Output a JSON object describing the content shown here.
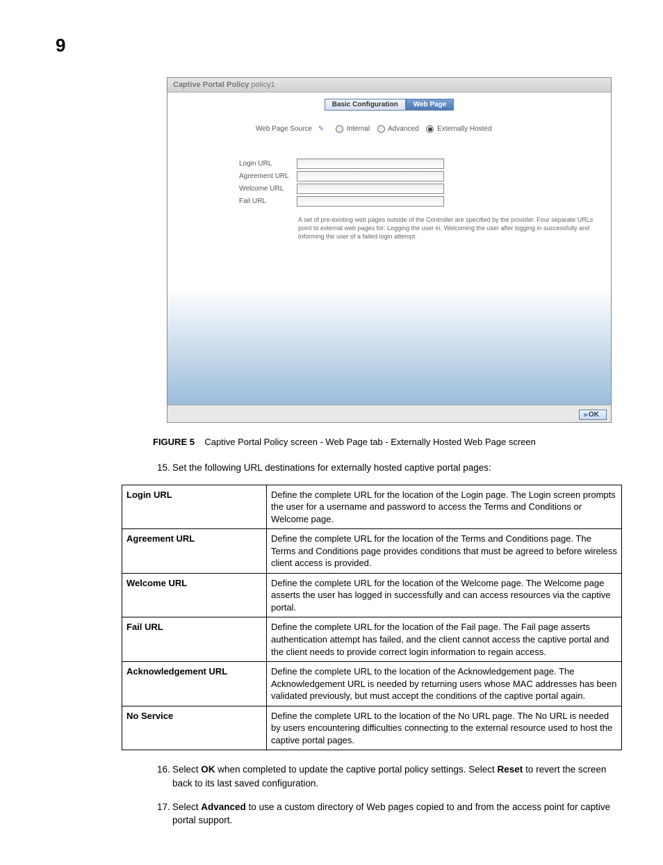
{
  "chapter": "9",
  "screenshot": {
    "title_label": "Captive Portal Policy",
    "title_value": "policy1",
    "tabs": {
      "basic": "Basic Configuration",
      "webpage": "Web Page"
    },
    "source_label": "Web Page Source",
    "radios": {
      "internal": "Internal",
      "advanced": "Advanced",
      "external": "Externally Hosted"
    },
    "url_labels": {
      "login": "Login URL",
      "agreement": "Agreement URL",
      "welcome": "Welcome URL",
      "fail": "Fail URL"
    },
    "note": "A set of pre-existing web pages outside of the Controller are specified by the provider. Four separate URLs point to external web pages for: Logging the user in, Welcoming the user after logging in successfully and Informing the user of a failed login attempt.",
    "ok": "OK"
  },
  "figure": {
    "label": "FIGURE 5",
    "caption": "Captive Portal Policy screen - Web Page tab - Externally Hosted Web Page screen"
  },
  "step15": {
    "num": "15.",
    "text": "Set the following URL destinations for externally hosted captive portal pages:"
  },
  "table": [
    {
      "term": "Login URL",
      "desc": "Define the complete URL for the location of the Login page. The Login screen prompts the user for a username and password to access the Terms and Conditions or Welcome page."
    },
    {
      "term": "Agreement URL",
      "desc": "Define the complete URL for the location of the Terms and Conditions page. The Terms and Conditions page provides conditions that must be agreed to before wireless client access is provided."
    },
    {
      "term": "Welcome URL",
      "desc": "Define the complete URL for the location of the Welcome page. The Welcome page asserts the user has logged in successfully and can access resources via the captive portal."
    },
    {
      "term": "Fail URL",
      "desc": "Define the complete URL for the location of the Fail page. The Fail page asserts authentication attempt has failed, and the client cannot access the captive portal and the client needs to provide correct login information to regain access."
    },
    {
      "term": "Acknowledgement URL",
      "desc": "Define the complete URL to the location of the Acknowledgement page. The Acknowledgement URL is needed by returning users whose MAC addresses has been validated previously, but must accept the conditions of the captive portal again."
    },
    {
      "term": "No Service",
      "desc": "Define the complete URL to the location of the No URL page. The No URL is needed by users encountering difficulties connecting to the external resource used to host the captive portal pages."
    }
  ],
  "step16": {
    "num": "16.",
    "pre": "Select ",
    "b1": "OK",
    "mid": " when completed to update the captive portal policy settings. Select ",
    "b2": "Reset",
    "post": " to revert the screen back to its last saved configuration."
  },
  "step17": {
    "num": "17.",
    "pre": "Select ",
    "b1": "Advanced",
    "post": " to use a custom directory of Web pages copied to and from the access point for captive portal support."
  }
}
